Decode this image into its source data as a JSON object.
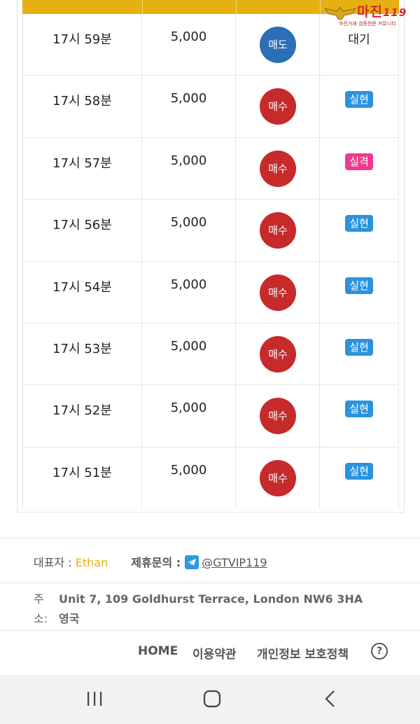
{
  "logo": {
    "brand": "마진",
    "brand_suffix": "119",
    "tagline": "마진거래 검증전문 커뮤니티"
  },
  "table": {
    "rows": [
      {
        "time": "17시 59분",
        "amount": "5,000",
        "position": "매도",
        "position_type": "sell",
        "result": "대기",
        "result_type": "plain"
      },
      {
        "time": "17시 58분",
        "amount": "5,000",
        "position": "매수",
        "position_type": "buy",
        "result": "실현",
        "result_type": "hit"
      },
      {
        "time": "17시 57분",
        "amount": "5,000",
        "position": "매수",
        "position_type": "buy",
        "result": "실격",
        "result_type": "miss"
      },
      {
        "time": "17시 56분",
        "amount": "5,000",
        "position": "매수",
        "position_type": "buy",
        "result": "실현",
        "result_type": "hit"
      },
      {
        "time": "17시 54분",
        "amount": "5,000",
        "position": "매수",
        "position_type": "buy",
        "result": "실현",
        "result_type": "hit"
      },
      {
        "time": "17시 53분",
        "amount": "5,000",
        "position": "매수",
        "position_type": "buy",
        "result": "실현",
        "result_type": "hit"
      },
      {
        "time": "17시 52분",
        "amount": "5,000",
        "position": "매수",
        "position_type": "buy",
        "result": "실현",
        "result_type": "hit"
      },
      {
        "time": "17시 51분",
        "amount": "5,000",
        "position": "매수",
        "position_type": "buy",
        "result": "실현",
        "result_type": "hit"
      }
    ]
  },
  "footer": {
    "ceo_label": "대표자 :",
    "ceo_name": "Ethan",
    "partner_label": "제휴문의 :",
    "partner_handle": "@GTVIP119",
    "address_label_1": "주",
    "address_label_2": "소:",
    "address_line_1": "Unit 7, 109 Goldhurst Terrace, London NW6 3HA",
    "address_line_2": "영국",
    "nav": {
      "home": "HOME",
      "terms": "이용약관",
      "privacy": "개인정보 보호정책",
      "help": "?"
    }
  },
  "colors": {
    "accent": "#e6b012",
    "buy": "#c62a2a",
    "sell": "#2b6fb6",
    "hit": "#2a93e0",
    "miss": "#ee3b8b"
  },
  "icons": {
    "telegram": "telegram-icon",
    "help": "help-circle-icon",
    "recents": "recents-icon",
    "home": "home-icon",
    "back": "back-icon"
  }
}
